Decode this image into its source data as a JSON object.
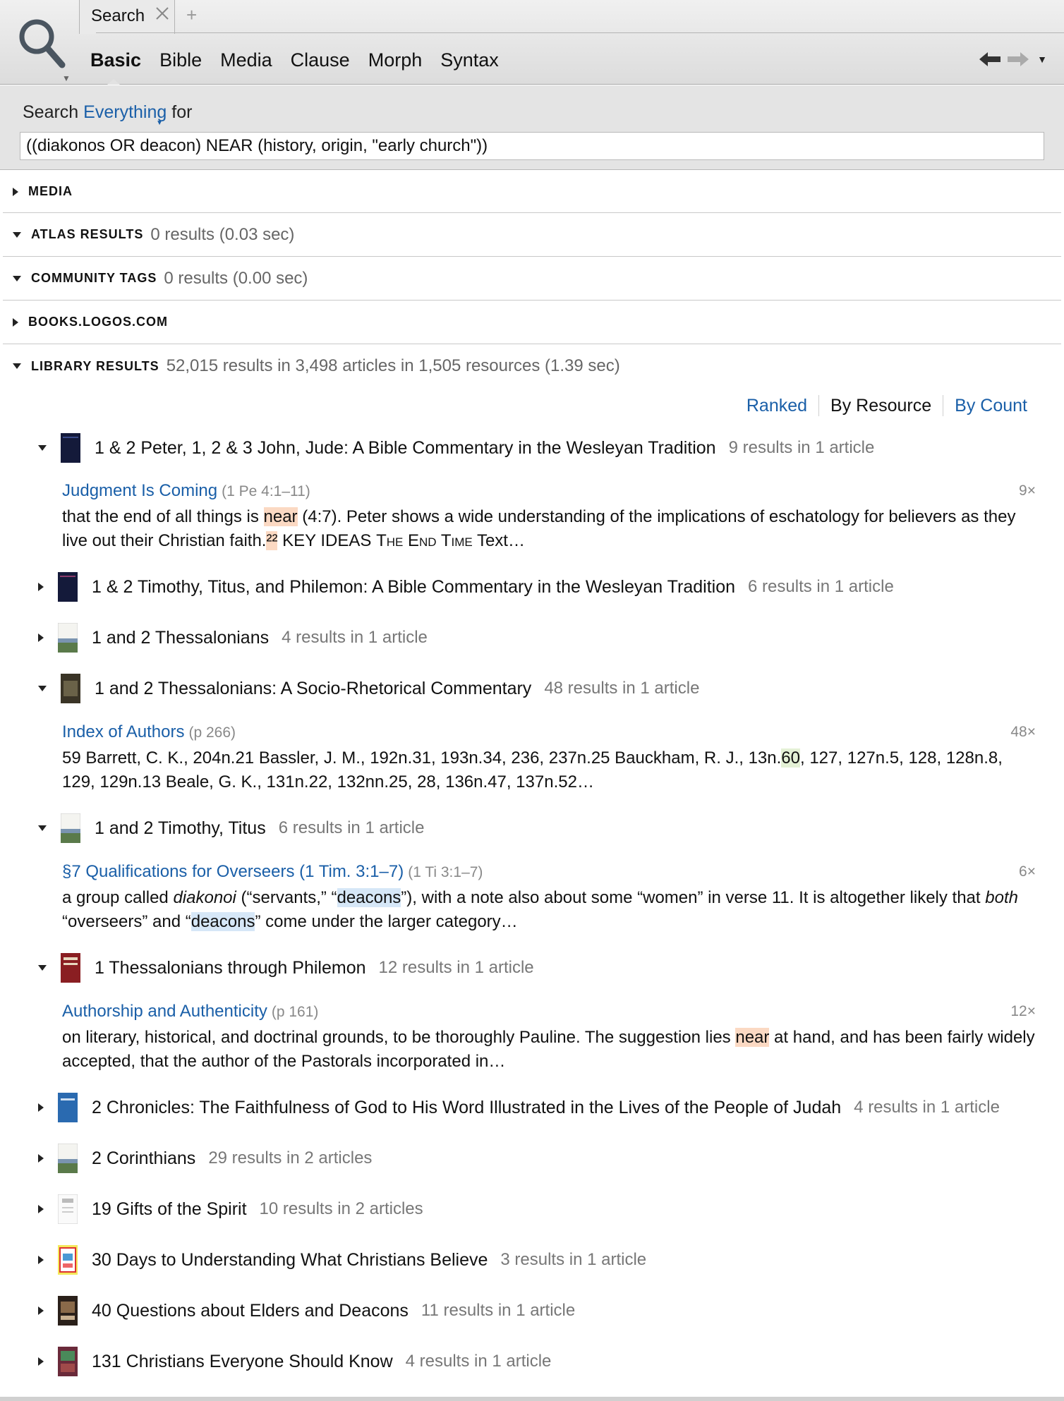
{
  "tab": {
    "label": "Search",
    "add": "+"
  },
  "nav": {
    "tabs": [
      "Basic",
      "Bible",
      "Media",
      "Clause",
      "Morph",
      "Syntax"
    ]
  },
  "search": {
    "prefix": "Search",
    "scope": "Everything",
    "suffix": "for",
    "query": "((diakonos OR deacon) NEAR (history, origin, \"early church\"))"
  },
  "sections": {
    "media": {
      "title": "MEDIA"
    },
    "atlas": {
      "title": "ATLAS RESULTS",
      "meta": "0 results (0.03 sec)"
    },
    "tags": {
      "title": "COMMUNITY TAGS",
      "meta": "0 results (0.00 sec)"
    },
    "books": {
      "title": "BOOKS.LOGOS.COM"
    },
    "library": {
      "title": "LIBRARY RESULTS",
      "meta": "52,015 results in 3,498 articles in 1,505 resources (1.39 sec)"
    }
  },
  "sort": {
    "ranked": "Ranked",
    "by_resource": "By Resource",
    "by_count": "By Count"
  },
  "results": [
    {
      "title": "1 & 2 Peter, 1, 2 & 3 John, Jude: A Bible Commentary in the Wesleyan Tradition",
      "meta": "9 results in 1 article"
    },
    {
      "title": "1 & 2 Timothy, Titus, and Philemon: A Bible Commentary in the Wesleyan Tradition",
      "meta": "6 results in 1 article"
    },
    {
      "title": "1 and 2 Thessalonians",
      "meta": "4 results in 1 article"
    },
    {
      "title": "1 and 2 Thessalonians: A Socio-Rhetorical Commentary",
      "meta": "48 results in 1 article"
    },
    {
      "title": "1 and 2 Timothy, Titus",
      "meta": "6 results in 1 article"
    },
    {
      "title": "1 Thessalonians through Philemon",
      "meta": "12 results in 1 article"
    },
    {
      "title": "2 Chronicles: The Faithfulness of God to His Word Illustrated in the Lives of the People of Judah",
      "meta": "4 results in 1 article"
    },
    {
      "title": "2 Corinthians",
      "meta": "29 results in 2 articles"
    },
    {
      "title": "19 Gifts of the Spirit",
      "meta": "10 results in 2 articles"
    },
    {
      "title": "30 Days to Understanding What Christians Believe",
      "meta": "3 results in 1 article"
    },
    {
      "title": "40 Questions about Elders and Deacons",
      "meta": "11 results in 1 article"
    },
    {
      "title": "131 Christians Everyone Should Know",
      "meta": "4 results in 1 article"
    }
  ],
  "hits": {
    "h1": {
      "link": "Judgment Is Coming",
      "ref": "(1 Pe 4:1–11)",
      "count": "9×",
      "t1": "that the end of all things is ",
      "m1": "near",
      "t2": " (4:7). Peter shows a wide understanding of the implications of eschatology for believers as they live out their Christian faith.",
      "m2": "²²",
      "t3": " KEY IDEAS ",
      "sc": "The End Time",
      "t4": " Text…"
    },
    "h2": {
      "link": "Index of Authors",
      "ref": "(p 266)",
      "count": "48×",
      "t1": "59 Barrett, C. K., 204n.21 Bassler, J. M., 192n.31, 193n.34, 236, 237n.25 Bauckham, R. J., 13n.",
      "m1": "60",
      "t2": ", 127, 127n.5, 128, 128n.8, 129, 129n.13 Beale, G. K., 131n.22, 132nn.25, 28, 136n.47, 137n.52…"
    },
    "h3": {
      "link": "§7 Qualifications for Overseers (1 Tim. 3:1–7)",
      "ref": "(1 Ti 3:1–7)",
      "count": "6×",
      "t1": "a group called ",
      "i1": "diakonoi",
      "t2": " (“servants,” “",
      "m1": "deacons",
      "t3": "”), with a note also about some “women” in verse 11. It is altogether likely that ",
      "i2": "both",
      "t4": " “overseers” and “",
      "m2": "deacons",
      "t5": "” come under the larger category…"
    },
    "h4": {
      "link": "Authorship and Authenticity",
      "ref": "(p 161)",
      "count": "12×",
      "t1": "on literary, historical, and doctrinal grounds, to be thoroughly Pauline. The suggestion lies ",
      "m1": "near",
      "t2": " at hand, and has been fairly widely accepted, that the author of the Pastorals incorporated in…"
    }
  },
  "icons": {
    "search": "magnifier-icon",
    "close": "close-icon",
    "back": "back-arrow-icon",
    "forward": "forward-arrow-icon"
  },
  "colors": {
    "link": "#1a5fa8",
    "highlight_near": "#fbd9c3",
    "highlight_deacons": "#d6e7f7"
  }
}
